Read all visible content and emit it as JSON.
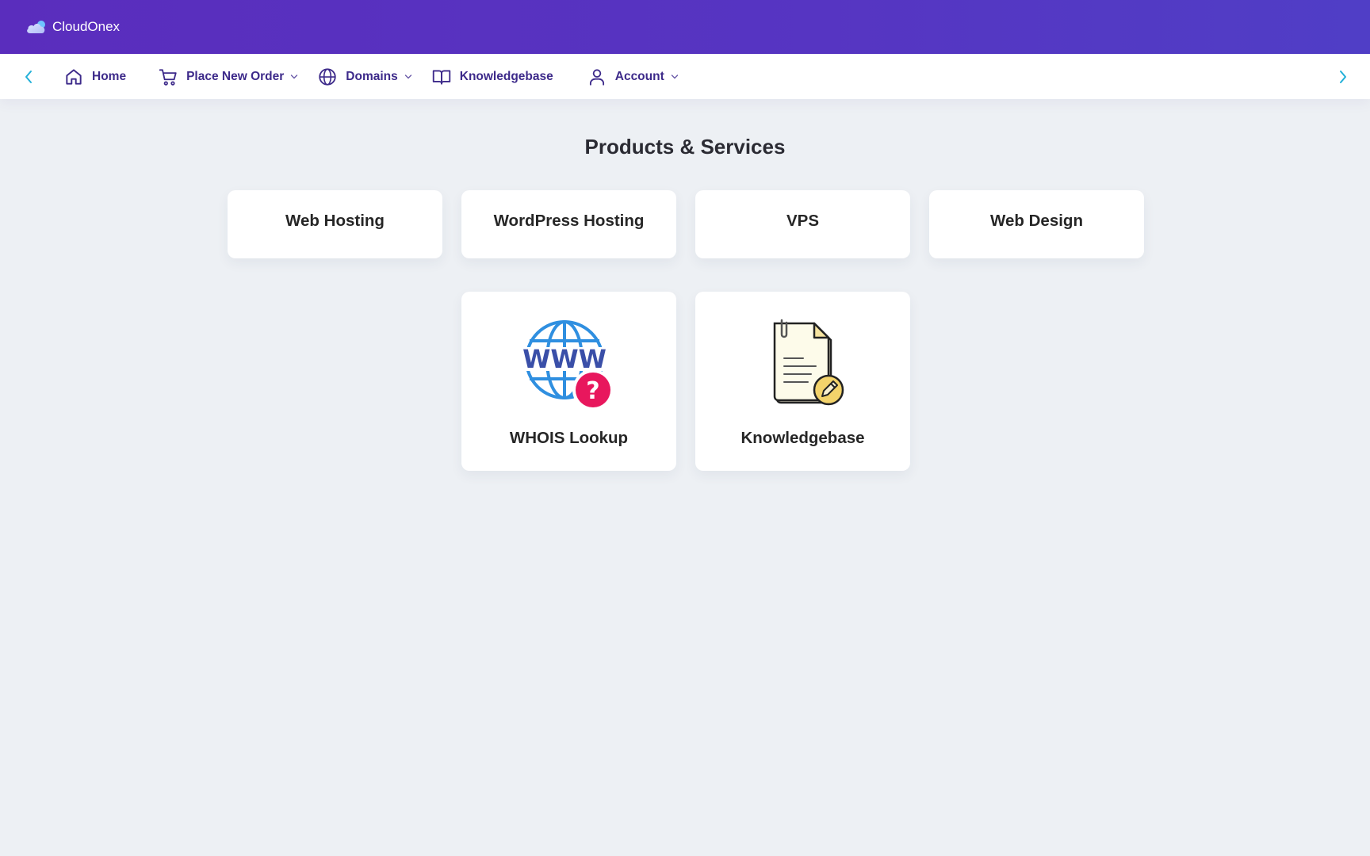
{
  "brand": {
    "name": "CloudOnex",
    "icon": "cloud-icon"
  },
  "nav": {
    "items": [
      {
        "label": "Home",
        "icon": "home-icon",
        "dropdown": false
      },
      {
        "label": "Place New Order",
        "icon": "cart-icon",
        "dropdown": true
      },
      {
        "label": "Domains",
        "icon": "globe-icon",
        "dropdown": true
      },
      {
        "label": "Knowledgebase",
        "icon": "book-icon",
        "dropdown": false
      },
      {
        "label": "Account",
        "icon": "user-icon",
        "dropdown": true
      }
    ]
  },
  "main": {
    "title": "Products & Services",
    "categories": [
      {
        "label": "Web Hosting"
      },
      {
        "label": "WordPress Hosting"
      },
      {
        "label": "VPS"
      },
      {
        "label": "Web Design"
      }
    ],
    "tools": [
      {
        "label": "WHOIS Lookup",
        "icon": "www-question-icon"
      },
      {
        "label": "Knowledgebase",
        "icon": "document-edit-icon"
      }
    ]
  },
  "colors": {
    "header_gradient_start": "#5a2dbd",
    "header_gradient_end": "#503ec6",
    "nav_text": "#3d2a8a",
    "nav_arrow": "#22b0d8",
    "background": "#edf0f4"
  }
}
